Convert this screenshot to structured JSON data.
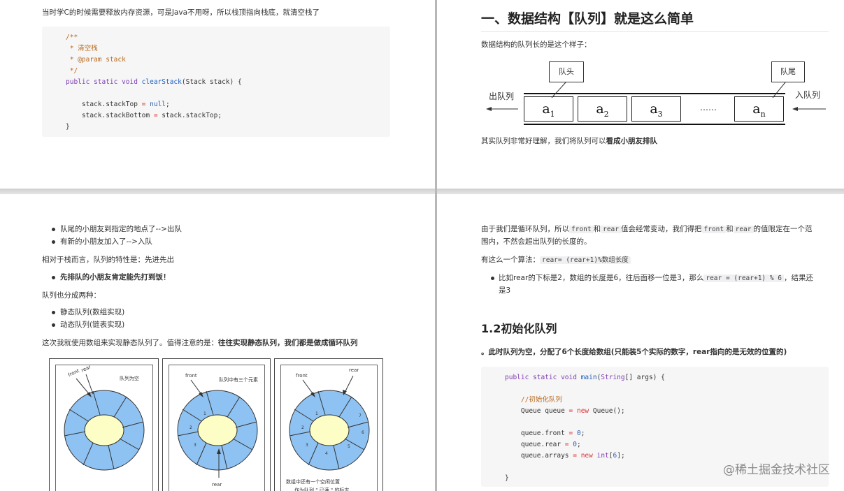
{
  "p1": {
    "intro": "当时学C的时候需要释放内存资源，可是Java不用呀，所以栈顶指向栈底，就清空栈了",
    "code": {
      "l1": "/**",
      "l2": " * 清空栈",
      "l3a": " * ",
      "l3b": "@param",
      "l3c": " stack",
      "l4": " */",
      "l5a": "public static void ",
      "l5b": "clearStack",
      "l5c": "(Stack stack) {",
      "l6a": "    stack.stackTop ",
      "l6b": "=",
      "l6c": " ",
      "l6d": "null",
      "l6e": ";",
      "l7a": "    stack.stackBottom ",
      "l7b": "=",
      "l7c": " stack.stackTop;",
      "l8": "}"
    }
  },
  "p2": {
    "heading": "一、数据结构【队列】就是这么简单",
    "intro": "数据结构的队列长的是这个样子：",
    "diagram": {
      "head": "队头",
      "tail": "队尾",
      "dequeue": "出队列",
      "enqueue": "入队列",
      "cells": [
        {
          "base": "a",
          "sub": "1"
        },
        {
          "base": "a",
          "sub": "2"
        },
        {
          "base": "a",
          "sub": "3"
        },
        {
          "base": "a",
          "sub": "n"
        }
      ],
      "ellipsis": "……"
    },
    "summary_a": "其实队列非常好理解，我们将队列可以",
    "summary_b": "看成小朋友排队"
  },
  "p3": {
    "bullets1": [
      "队尾的小朋友到指定的地点了-->出队",
      "有新的小朋友加入了-->入队"
    ],
    "compare": "相对于栈而言，队列的特性是：先进先出",
    "bullet_bold": "先排队的小朋友肯定能先打到饭！",
    "types_intro": "队列也分成两种：",
    "bullets2": [
      "静态队列(数组实现)",
      "动态队列(链表实现)"
    ],
    "note_a": "这次我就使用数组来实现静态队列了。值得注意的是：",
    "note_b": "往往实现静态队列，我们都是做成循环队列",
    "fig1": {
      "front": "front",
      "rear": "rear",
      "caption": "队列为空"
    },
    "fig2": {
      "front": "front",
      "caption": "队列中有三个元素",
      "rear": "rear",
      "nums": [
        "1",
        "2",
        "3"
      ]
    },
    "fig3": {
      "front": "front",
      "rear": "rear",
      "nums": [
        "1",
        "2",
        "3",
        "4",
        "5",
        "6",
        "7"
      ],
      "note1": "数组中还有一个空闲位置",
      "note2": "作为队列 \" 已满 \" 的标志"
    }
  },
  "p4": {
    "para1_a": "由于我们是循环队列，所以",
    "para1_c1": "front",
    "para1_b": "和",
    "para1_c2": "rear",
    "para1_c": "值会经常变动，我们得把",
    "para1_c3": "front",
    "para1_d": "和",
    "para1_c4": "rear",
    "para1_e": "的值限定在一个范",
    "para1_line2": "围内，不然会超出队列的长度的。",
    "algo_a": "有这么一个算法：",
    "algo_code": "rear= (rear+1)%数组长度",
    "bullet_a": "比如rear的下标是2，数组的长度是6，往后面移一位是3，那么",
    "bullet_code": "rear =  (rear+1) % 6",
    "bullet_b": "，结果还",
    "bullet_line2": "是3",
    "heading": "1.2初始化队列",
    "bold_note": "。此时队列为空，分配了6个长度给数组(只能装5个实际的数字，rear指向的是无效的位置的)",
    "code": {
      "l1a": "public static void ",
      "l1b": "main",
      "l1c": "(",
      "l1d": "String",
      "l1e": "[] args) {",
      "l2": "    //初始化队列",
      "l3a": "    Queue queue ",
      "l3b": "=",
      "l3c": " ",
      "l3d": "new",
      "l3e": " Queue();",
      "l4a": "    queue.front ",
      "l4b": "=",
      "l4c": " ",
      "l4d": "0",
      "l4e": ";",
      "l5a": "    queue.rear ",
      "l5b": "=",
      "l5c": " ",
      "l5d": "0",
      "l5e": ";",
      "l6a": "    queue.arrays ",
      "l6b": "=",
      "l6c": " ",
      "l6d": "new",
      "l6e": " ",
      "l6f": "int",
      "l6g": "[",
      "l6h": "6",
      "l6i": "];",
      "l7": "}"
    },
    "watermark": "@稀土掘金技术社区"
  }
}
